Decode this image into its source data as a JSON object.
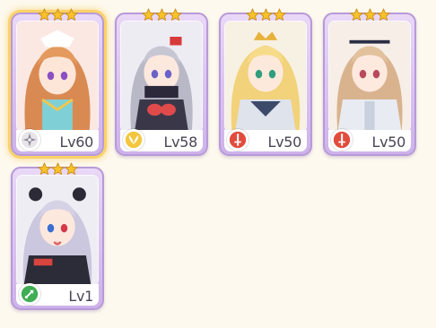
{
  "roster": {
    "cards": [
      {
        "level_text": "Lv60",
        "stars": 3,
        "class_icon": "compass-rose-icon",
        "class_color": "#e7e4ea",
        "selected": true
      },
      {
        "level_text": "Lv58",
        "stars": 3,
        "class_icon": "wings-icon",
        "class_color": "#f4c63e",
        "selected": false
      },
      {
        "level_text": "Lv50",
        "stars": 3,
        "class_icon": "sword-icon",
        "class_color": "#e14c3c",
        "selected": false
      },
      {
        "level_text": "Lv50",
        "stars": 3,
        "class_icon": "sword-icon",
        "class_color": "#e14c3c",
        "selected": false
      },
      {
        "level_text": "Lv1",
        "stars": 3,
        "class_icon": "arrow-icon",
        "class_color": "#3fae55",
        "selected": false
      }
    ]
  },
  "colors": {
    "background": "#fdf9ee",
    "card_frame": "#cdb2ea",
    "star_gold": "#f8c22b",
    "selected_glow": "#fbd268"
  }
}
